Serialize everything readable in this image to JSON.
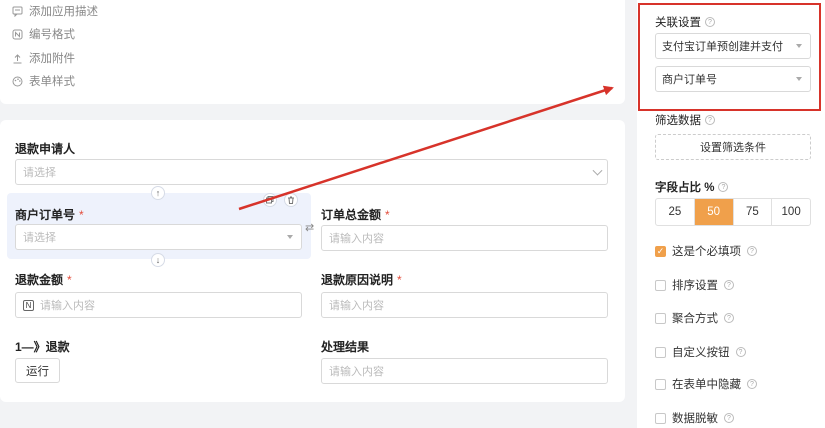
{
  "top_options": [
    {
      "icon": "comment-icon",
      "label": "添加应用描述"
    },
    {
      "icon": "number-format-icon",
      "label": "编号格式"
    },
    {
      "icon": "upload-icon",
      "label": "添加附件"
    },
    {
      "icon": "palette-icon",
      "label": "表单样式"
    }
  ],
  "form": {
    "refund_applicant": {
      "label": "退款申请人",
      "placeholder": "请选择"
    },
    "merchant_order_no": {
      "label": "商户订单号",
      "required": "*",
      "placeholder": "请选择"
    },
    "order_total": {
      "label": "订单总金额",
      "required": "*",
      "placeholder": "请输入内容"
    },
    "refund_amount": {
      "label": "退款金额",
      "required": "*",
      "placeholder": "请输入内容",
      "prefix_icon": "N"
    },
    "refund_reason": {
      "label": "退款原因说明",
      "required": "*",
      "placeholder": "请输入内容"
    },
    "refund_step": {
      "label": "1—》退款",
      "button": "运行"
    },
    "result": {
      "label": "处理结果",
      "placeholder": "请输入内容"
    }
  },
  "panel": {
    "link_settings_label": "关联设置",
    "link_select_1": "支付宝订单预创建并支付",
    "link_select_2": "商户订单号",
    "filter_label": "筛选数据",
    "filter_button": "设置筛选条件",
    "width_label": "字段占比 %",
    "width_options": [
      "25",
      "50",
      "75",
      "100"
    ],
    "width_selected": "50",
    "checkboxes": [
      {
        "label": "这是个必填项",
        "checked": true
      },
      {
        "label": "排序设置",
        "checked": false
      },
      {
        "label": "聚合方式",
        "checked": false
      },
      {
        "label": "自定义按钮",
        "checked": false
      },
      {
        "label": "在表单中隐藏",
        "checked": false
      },
      {
        "label": "数据脱敏",
        "checked": false
      }
    ]
  },
  "colors": {
    "accent": "#f0a04b",
    "annotation": "#d7332a",
    "selected_bg": "#eef2fc"
  }
}
